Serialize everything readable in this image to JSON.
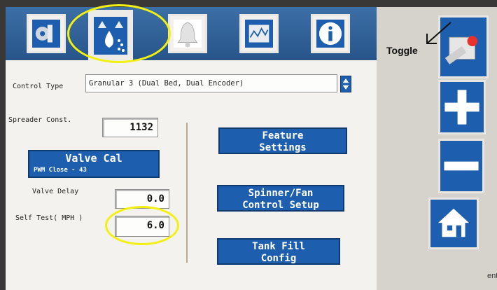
{
  "control": {
    "label": "Control Type",
    "value": "Granular 3 (Dual Bed, Dual Encoder)"
  },
  "spreader": {
    "label": "Spreader Const.",
    "value": "1132"
  },
  "valve_cal": {
    "label": "Valve Cal",
    "sub": "PWM Close - 43"
  },
  "valve_delay": {
    "label": "Valve Delay",
    "value": "0.0"
  },
  "self_test": {
    "label": "Self Test( MPH )",
    "value": "6.0"
  },
  "buttons": {
    "feature": [
      "Feature",
      "Settings"
    ],
    "spinner": [
      "Spinner/Fan",
      "Control Setup"
    ],
    "tank": [
      "Tank Fill",
      "Config"
    ]
  },
  "annotation": {
    "toggle": "Toggle"
  },
  "edge_text": "ent",
  "colors": {
    "accent": "#1d5fae",
    "highlight": "#f3f011"
  },
  "tabs": [
    "tools-icon",
    "granular-spreader-icon",
    "bell-icon",
    "chart-icon",
    "info-icon"
  ],
  "sidebar": [
    "toggle-switch-icon",
    "plus-icon",
    "minus-icon",
    "home-icon"
  ]
}
